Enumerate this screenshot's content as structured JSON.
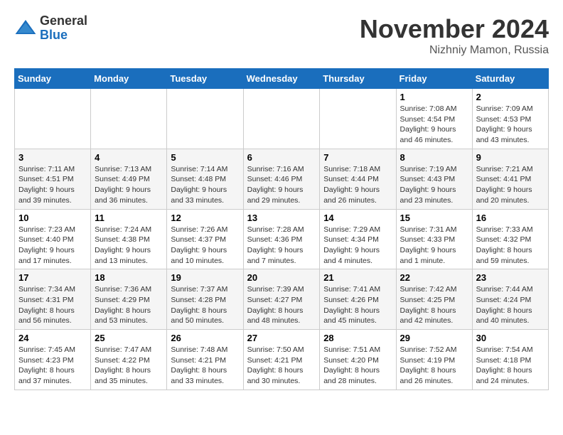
{
  "logo": {
    "general": "General",
    "blue": "Blue"
  },
  "header": {
    "month": "November 2024",
    "location": "Nizhniy Mamon, Russia"
  },
  "days_of_week": [
    "Sunday",
    "Monday",
    "Tuesday",
    "Wednesday",
    "Thursday",
    "Friday",
    "Saturday"
  ],
  "weeks": [
    [
      {
        "day": "",
        "info": ""
      },
      {
        "day": "",
        "info": ""
      },
      {
        "day": "",
        "info": ""
      },
      {
        "day": "",
        "info": ""
      },
      {
        "day": "",
        "info": ""
      },
      {
        "day": "1",
        "info": "Sunrise: 7:08 AM\nSunset: 4:54 PM\nDaylight: 9 hours and 46 minutes."
      },
      {
        "day": "2",
        "info": "Sunrise: 7:09 AM\nSunset: 4:53 PM\nDaylight: 9 hours and 43 minutes."
      }
    ],
    [
      {
        "day": "3",
        "info": "Sunrise: 7:11 AM\nSunset: 4:51 PM\nDaylight: 9 hours and 39 minutes."
      },
      {
        "day": "4",
        "info": "Sunrise: 7:13 AM\nSunset: 4:49 PM\nDaylight: 9 hours and 36 minutes."
      },
      {
        "day": "5",
        "info": "Sunrise: 7:14 AM\nSunset: 4:48 PM\nDaylight: 9 hours and 33 minutes."
      },
      {
        "day": "6",
        "info": "Sunrise: 7:16 AM\nSunset: 4:46 PM\nDaylight: 9 hours and 29 minutes."
      },
      {
        "day": "7",
        "info": "Sunrise: 7:18 AM\nSunset: 4:44 PM\nDaylight: 9 hours and 26 minutes."
      },
      {
        "day": "8",
        "info": "Sunrise: 7:19 AM\nSunset: 4:43 PM\nDaylight: 9 hours and 23 minutes."
      },
      {
        "day": "9",
        "info": "Sunrise: 7:21 AM\nSunset: 4:41 PM\nDaylight: 9 hours and 20 minutes."
      }
    ],
    [
      {
        "day": "10",
        "info": "Sunrise: 7:23 AM\nSunset: 4:40 PM\nDaylight: 9 hours and 17 minutes."
      },
      {
        "day": "11",
        "info": "Sunrise: 7:24 AM\nSunset: 4:38 PM\nDaylight: 9 hours and 13 minutes."
      },
      {
        "day": "12",
        "info": "Sunrise: 7:26 AM\nSunset: 4:37 PM\nDaylight: 9 hours and 10 minutes."
      },
      {
        "day": "13",
        "info": "Sunrise: 7:28 AM\nSunset: 4:36 PM\nDaylight: 9 hours and 7 minutes."
      },
      {
        "day": "14",
        "info": "Sunrise: 7:29 AM\nSunset: 4:34 PM\nDaylight: 9 hours and 4 minutes."
      },
      {
        "day": "15",
        "info": "Sunrise: 7:31 AM\nSunset: 4:33 PM\nDaylight: 9 hours and 1 minute."
      },
      {
        "day": "16",
        "info": "Sunrise: 7:33 AM\nSunset: 4:32 PM\nDaylight: 8 hours and 59 minutes."
      }
    ],
    [
      {
        "day": "17",
        "info": "Sunrise: 7:34 AM\nSunset: 4:31 PM\nDaylight: 8 hours and 56 minutes."
      },
      {
        "day": "18",
        "info": "Sunrise: 7:36 AM\nSunset: 4:29 PM\nDaylight: 8 hours and 53 minutes."
      },
      {
        "day": "19",
        "info": "Sunrise: 7:37 AM\nSunset: 4:28 PM\nDaylight: 8 hours and 50 minutes."
      },
      {
        "day": "20",
        "info": "Sunrise: 7:39 AM\nSunset: 4:27 PM\nDaylight: 8 hours and 48 minutes."
      },
      {
        "day": "21",
        "info": "Sunrise: 7:41 AM\nSunset: 4:26 PM\nDaylight: 8 hours and 45 minutes."
      },
      {
        "day": "22",
        "info": "Sunrise: 7:42 AM\nSunset: 4:25 PM\nDaylight: 8 hours and 42 minutes."
      },
      {
        "day": "23",
        "info": "Sunrise: 7:44 AM\nSunset: 4:24 PM\nDaylight: 8 hours and 40 minutes."
      }
    ],
    [
      {
        "day": "24",
        "info": "Sunrise: 7:45 AM\nSunset: 4:23 PM\nDaylight: 8 hours and 37 minutes."
      },
      {
        "day": "25",
        "info": "Sunrise: 7:47 AM\nSunset: 4:22 PM\nDaylight: 8 hours and 35 minutes."
      },
      {
        "day": "26",
        "info": "Sunrise: 7:48 AM\nSunset: 4:21 PM\nDaylight: 8 hours and 33 minutes."
      },
      {
        "day": "27",
        "info": "Sunrise: 7:50 AM\nSunset: 4:21 PM\nDaylight: 8 hours and 30 minutes."
      },
      {
        "day": "28",
        "info": "Sunrise: 7:51 AM\nSunset: 4:20 PM\nDaylight: 8 hours and 28 minutes."
      },
      {
        "day": "29",
        "info": "Sunrise: 7:52 AM\nSunset: 4:19 PM\nDaylight: 8 hours and 26 minutes."
      },
      {
        "day": "30",
        "info": "Sunrise: 7:54 AM\nSunset: 4:18 PM\nDaylight: 8 hours and 24 minutes."
      }
    ]
  ]
}
